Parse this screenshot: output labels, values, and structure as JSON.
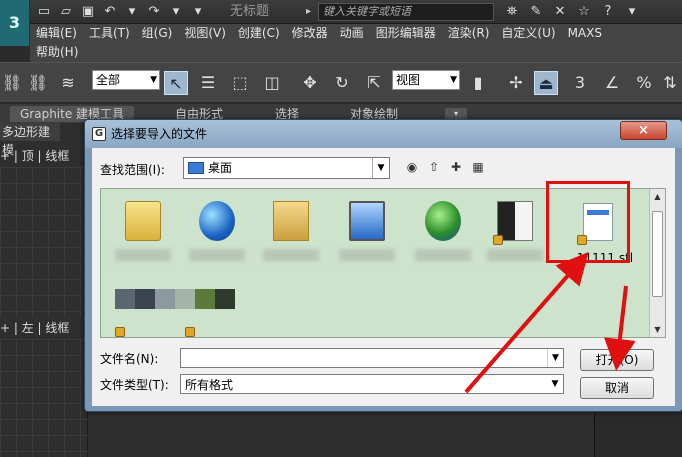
{
  "app": {
    "logo": "3",
    "title": "无标题",
    "search_placeholder": "键入关键字或短语"
  },
  "menu": {
    "row1": [
      "编辑(E)",
      "工具(T)",
      "组(G)",
      "视图(V)",
      "创建(C)",
      "修改器",
      "动画",
      "图形编辑器",
      "渲染(R)",
      "自定义(U)",
      "MAXS"
    ],
    "row2": [
      "帮助(H)"
    ]
  },
  "toolbar": {
    "selection_filter": "全部",
    "ref_coord": "视图",
    "snap_label": "3"
  },
  "ribbon": {
    "tabs": [
      "Graphite 建模工具",
      "自由形式",
      "选择",
      "对象绘制"
    ]
  },
  "left_panel": {
    "tab": "多边形建模",
    "vp_top_label": "+ | 顶 | 线框",
    "vp_left_label": "+ | 左 | 线框"
  },
  "dialog": {
    "title": "选择要导入的文件",
    "close": "×",
    "look_in_label": "查找范围(I):",
    "look_in_value": "桌面",
    "file_name_label": "文件名(N):",
    "file_name_value": "",
    "file_type_label": "文件类型(T):",
    "file_type_value": "所有格式",
    "open_button": "打开(O)",
    "cancel_button": "取消",
    "highlighted_file": "11111.stl"
  },
  "icons": {
    "back": "back-icon",
    "up": "folder-up-icon",
    "new_folder": "new-folder-icon",
    "view": "view-menu-icon"
  },
  "colors": {
    "annotation_red": "#e01010",
    "file_list_bg": "#cde3cc",
    "dialog_frame": "#7b98b8"
  }
}
